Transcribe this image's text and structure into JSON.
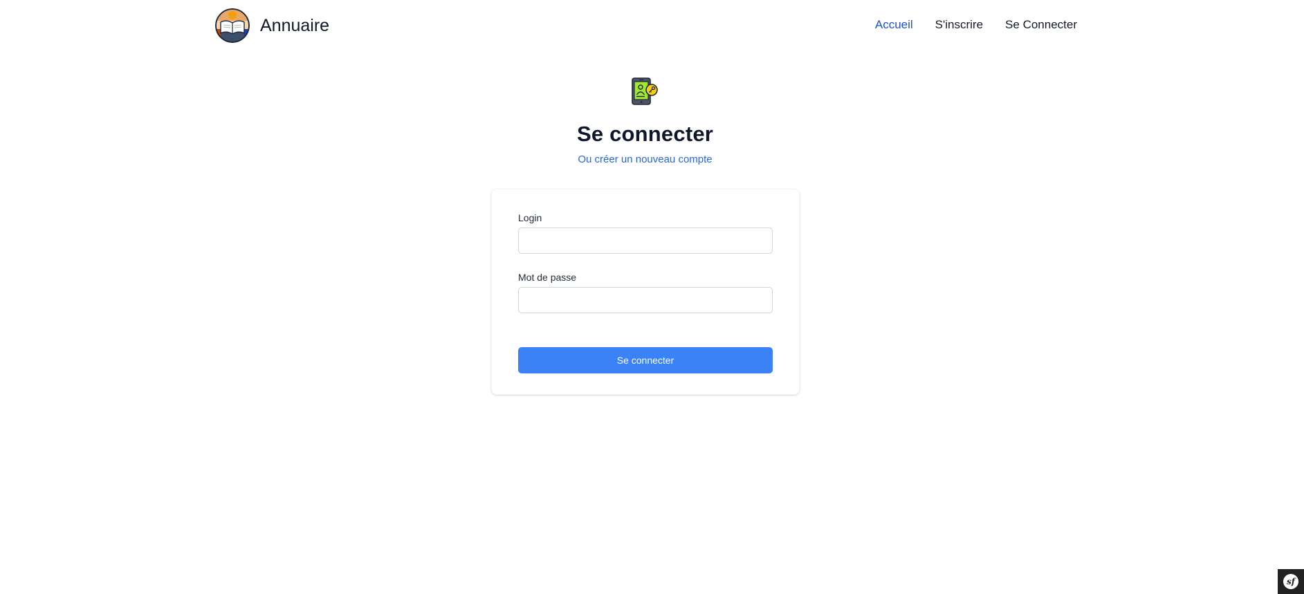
{
  "header": {
    "brand_name": "Annuaire",
    "nav": {
      "home": "Accueil",
      "register": "S'inscrire",
      "login": "Se Connecter"
    }
  },
  "hero": {
    "icon": "mobile-user-key-icon",
    "title": "Se connecter",
    "subtitle_prefix": "Ou",
    "subtitle_link": "créer un nouveau compte"
  },
  "form": {
    "login_label": "Login",
    "login_value": "",
    "password_label": "Mot de passe",
    "password_value": "",
    "submit_label": "Se connecter"
  },
  "debug_toolbar": {
    "label": "sf"
  },
  "colors": {
    "accent": "#3b82f6",
    "nav_active": "#1d4ed8",
    "link": "#2563eb",
    "text": "#111827"
  }
}
